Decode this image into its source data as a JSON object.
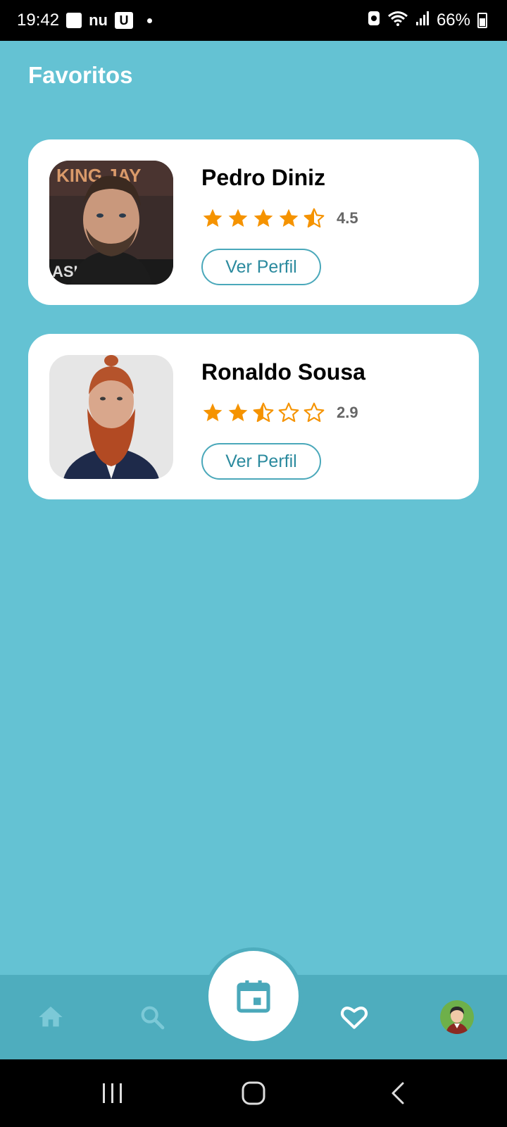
{
  "status_bar": {
    "time": "19:42",
    "carrier": "nu",
    "u_badge": "U",
    "battery": "66%"
  },
  "page": {
    "title": "Favoritos"
  },
  "favorites": [
    {
      "name": "Pedro Diniz",
      "rating": 4.5,
      "rating_text": "4.5",
      "stars": [
        "full",
        "full",
        "full",
        "full",
        "half"
      ],
      "button_label": "Ver Perfil",
      "photo_text": "KING JAY"
    },
    {
      "name": "Ronaldo Sousa",
      "rating": 2.9,
      "rating_text": "2.9",
      "stars": [
        "full",
        "full",
        "half",
        "empty",
        "empty"
      ],
      "button_label": "Ver Perfil"
    }
  ],
  "colors": {
    "background": "#64c2d3",
    "nav_background": "#4eadbe",
    "star": "#f59300",
    "button_border": "#4aa8ba",
    "button_text": "#2b8a9e"
  },
  "bottom_nav": {
    "items": [
      "home-icon",
      "search-icon",
      "calendar-icon",
      "heart-icon",
      "profile-avatar"
    ],
    "active": "heart-icon"
  }
}
